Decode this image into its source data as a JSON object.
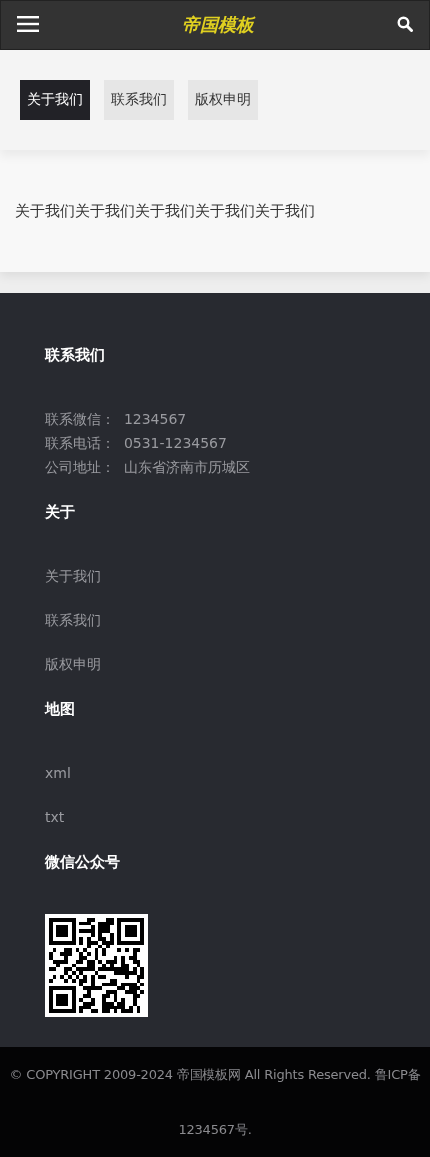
{
  "header": {
    "title": "帝国模板"
  },
  "tabs": [
    {
      "label": "关于我们",
      "selected": true
    },
    {
      "label": "联系我们",
      "selected": false
    },
    {
      "label": "版权申明",
      "selected": false
    }
  ],
  "content": {
    "text": "关于我们关于我们关于我们关于我们关于我们"
  },
  "footer": {
    "sections": [
      {
        "title": "联系我们",
        "kind": "contact",
        "lines": [
          "联系微信：  1234567",
          "联系电话：  0531-1234567",
          "公司地址：  山东省济南市历城区"
        ]
      },
      {
        "title": "关于",
        "kind": "links",
        "links": [
          "关于我们",
          "联系我们",
          "版权申明"
        ]
      },
      {
        "title": "地图",
        "kind": "links",
        "links": [
          "xml",
          "txt"
        ]
      },
      {
        "title": "微信公众号",
        "kind": "qr"
      }
    ]
  },
  "copyright": "© COPYRIGHT 2009-2024 帝国模板网 All Rights Reserved. 鲁ICP备1234567号."
}
